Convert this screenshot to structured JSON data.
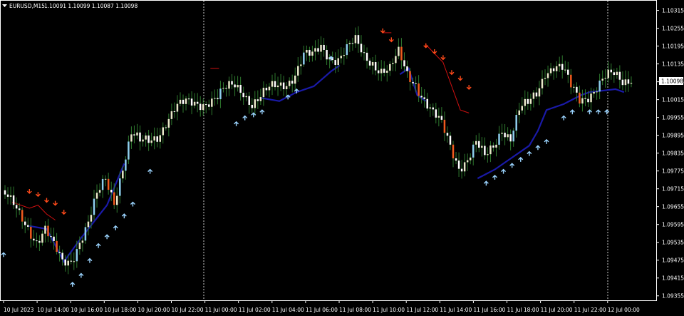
{
  "window": {
    "title": "EURUSD,M15",
    "ohlc_readout": "1.10091 1.10099 1.10087 1.10098",
    "menu_icon": "triangle-down-icon"
  },
  "colors": {
    "background": "#000000",
    "frame": "#ffffff",
    "bull_candle": "#8ecfee",
    "bear_candle": "#f05a1e",
    "neutral_candle_up": "#e8e8c8",
    "neutral_candle_down": "#ffffff",
    "neutral_wick": "#2f7a2f",
    "lower_band": "#1a1aa8",
    "upper_band": "#d01010",
    "buy_arrow": "#9bd4ff",
    "sell_arrow": "#ff4a1a",
    "price_tag_bg": "#ffffff",
    "price_tag_text": "#000000",
    "separator": "#ffffff"
  },
  "chart_data": {
    "type": "candlestick",
    "symbol": "EURUSD",
    "timeframe": "M15",
    "current_price_label": "1.10098",
    "y_ticks": [
      "1.10315",
      "1.10255",
      "1.10195",
      "1.10135",
      "1.10075",
      "1.10015",
      "1.09955",
      "1.09895",
      "1.09835",
      "1.09775",
      "1.09715",
      "1.09655",
      "1.09595",
      "1.09535",
      "1.09475",
      "1.09415",
      "1.09355"
    ],
    "x_ticks": [
      "10 Jul 2023",
      "10 Jul 14:00",
      "10 Jul 16:00",
      "10 Jul 18:00",
      "10 Jul 20:00",
      "10 Jul 22:00",
      "11 Jul 00:00",
      "11 Jul 02:00",
      "11 Jul 04:00",
      "11 Jul 06:00",
      "11 Jul 08:00",
      "11 Jul 10:00",
      "11 Jul 12:00",
      "11 Jul 14:00",
      "11 Jul 16:00",
      "11 Jul 18:00",
      "11 Jul 20:00",
      "11 Jul 22:00",
      "12 Jul 00:00"
    ],
    "ylim": [
      1.0934,
      1.1035
    ],
    "day_separators": [
      "11 Jul 00:00",
      "12 Jul 00:00"
    ],
    "price_path": [
      [
        0,
        1.0971
      ],
      [
        1,
        1.0966
      ],
      [
        2,
        1.0962
      ],
      [
        3,
        1.0959
      ],
      [
        4,
        1.0955
      ],
      [
        5,
        1.0958
      ],
      [
        6,
        1.0951
      ],
      [
        7,
        1.0946
      ],
      [
        8,
        1.0948
      ],
      [
        9,
        1.0955
      ],
      [
        10,
        1.096
      ],
      [
        11,
        1.0968
      ],
      [
        12,
        1.0974
      ],
      [
        13,
        1.0968
      ],
      [
        14,
        1.098
      ],
      [
        15,
        1.099
      ],
      [
        16,
        1.0986
      ],
      [
        17,
        1.0987
      ],
      [
        18,
        1.099
      ],
      [
        19,
        1.0995
      ],
      [
        20,
        1.0998
      ],
      [
        21,
        1.0999
      ],
      [
        22,
        1.1
      ],
      [
        23,
        1.1001
      ],
      [
        24,
        1.1002
      ],
      [
        25,
        1.1002
      ],
      [
        26,
        1.1004
      ],
      [
        27,
        1.1006
      ],
      [
        28,
        1.1005
      ],
      [
        29,
        1.1001
      ],
      [
        30,
        1.1002
      ],
      [
        31,
        1.1004
      ],
      [
        32,
        1.1006
      ],
      [
        33,
        1.1008
      ],
      [
        34,
        1.1011
      ],
      [
        35,
        1.1016
      ],
      [
        36,
        1.1015
      ],
      [
        37,
        1.1019
      ],
      [
        38,
        1.1017
      ],
      [
        39,
        1.1016
      ],
      [
        40,
        1.1018
      ],
      [
        41,
        1.102
      ],
      [
        42,
        1.1016
      ],
      [
        43,
        1.1015
      ],
      [
        44,
        1.1012
      ],
      [
        45,
        1.1011
      ],
      [
        46,
        1.1016
      ],
      [
        47,
        1.101
      ],
      [
        48,
        1.1008
      ],
      [
        49,
        1.1002
      ],
      [
        50,
        1.0996
      ],
      [
        51,
        1.0992
      ],
      [
        52,
        1.0986
      ],
      [
        53,
        1.098
      ],
      [
        54,
        1.0982
      ],
      [
        55,
        1.0986
      ],
      [
        56,
        1.0981
      ],
      [
        57,
        1.0986
      ],
      [
        58,
        1.0993
      ],
      [
        59,
        1.0989
      ],
      [
        60,
        1.0997
      ],
      [
        61,
        1.0999
      ],
      [
        62,
        1.1004
      ],
      [
        63,
        1.1012
      ],
      [
        64,
        1.1013
      ],
      [
        65,
        1.1011
      ],
      [
        66,
        1.1005
      ],
      [
        67,
        1.1002
      ],
      [
        68,
        1.1004
      ],
      [
        69,
        1.1006
      ],
      [
        70,
        1.1008
      ],
      [
        71,
        1.1009
      ],
      [
        72,
        1.1008
      ],
      [
        73,
        1.101
      ]
    ],
    "lower_band_path": [
      [
        3,
        1.0959
      ],
      [
        5,
        1.0958
      ],
      [
        7,
        1.0947
      ],
      [
        9,
        1.0955
      ],
      [
        12,
        1.0966
      ],
      [
        14,
        1.098
      ],
      [
        30,
        1.1002
      ],
      [
        32,
        1.1001
      ],
      [
        34,
        1.1004
      ],
      [
        36,
        1.1006
      ],
      [
        38,
        1.1011
      ],
      [
        39,
        1.1013
      ],
      [
        46,
        1.101
      ],
      [
        47,
        1.1012
      ],
      [
        48,
        1.1003
      ],
      [
        49,
        1.1001
      ],
      [
        55,
        1.0975
      ],
      [
        57,
        1.0978
      ],
      [
        59,
        1.0982
      ],
      [
        61,
        1.0986
      ],
      [
        62,
        1.0991
      ],
      [
        63,
        1.0998
      ],
      [
        65,
        1.1
      ],
      [
        67,
        1.1003
      ],
      [
        68,
        1.1004
      ],
      [
        71,
        1.1005
      ],
      [
        72,
        1.1004
      ]
    ],
    "upper_band_path": [
      [
        1,
        1.0967
      ],
      [
        3,
        1.0965
      ],
      [
        4,
        1.0966
      ],
      [
        5,
        1.0963
      ],
      [
        6,
        1.0961
      ],
      [
        24,
        1.1012
      ],
      [
        25,
        1.1012
      ],
      [
        44,
        1.1024
      ],
      [
        45,
        1.1024
      ],
      [
        49,
        1.102
      ],
      [
        51,
        1.1014
      ],
      [
        52,
        1.1006
      ],
      [
        53,
        1.0998
      ],
      [
        54,
        1.0997
      ]
    ],
    "buy_signals": [
      [
        0,
        1.095
      ],
      [
        8,
        1.094
      ],
      [
        9,
        1.0943
      ],
      [
        10,
        1.0948
      ],
      [
        11,
        1.0953
      ],
      [
        12,
        1.0956
      ],
      [
        13,
        1.0959
      ],
      [
        14,
        1.0963
      ],
      [
        15,
        1.0967
      ],
      [
        17,
        1.0978
      ],
      [
        27,
        1.0994
      ],
      [
        28,
        1.0996
      ],
      [
        29,
        1.0997
      ],
      [
        30,
        1.0998
      ],
      [
        33,
        1.1003
      ],
      [
        34,
        1.1005
      ],
      [
        38,
        1.1016
      ],
      [
        56,
        1.0974
      ],
      [
        57,
        1.0976
      ],
      [
        58,
        1.0978
      ],
      [
        59,
        1.098
      ],
      [
        60,
        1.0982
      ],
      [
        61,
        1.0984
      ],
      [
        62,
        1.0986
      ],
      [
        63,
        1.0988
      ],
      [
        65,
        1.0996
      ],
      [
        66,
        1.0998
      ],
      [
        68,
        1.0998
      ],
      [
        69,
        1.0998
      ],
      [
        70,
        1.0998
      ]
    ],
    "sell_signals": [
      [
        3,
        1.097
      ],
      [
        4,
        1.0969
      ],
      [
        5,
        1.0967
      ],
      [
        6,
        1.0966
      ],
      [
        7,
        1.0963
      ],
      [
        44,
        1.1024
      ],
      [
        45,
        1.1021
      ],
      [
        49,
        1.1019
      ],
      [
        50,
        1.1017
      ],
      [
        51,
        1.1015
      ],
      [
        52,
        1.101
      ],
      [
        53,
        1.1008
      ],
      [
        54,
        1.1005
      ]
    ]
  }
}
